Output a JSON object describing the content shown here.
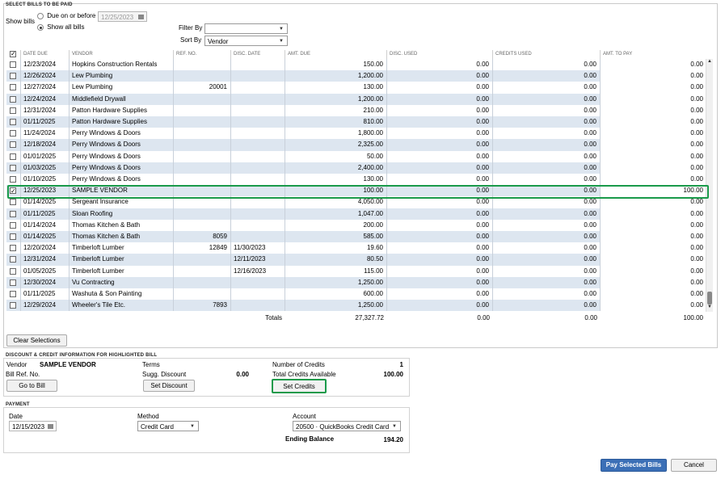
{
  "select_section": {
    "title": "SELECT BILLS TO BE PAID",
    "show_bills_label": "Show bills",
    "option_due": "Due on or before",
    "option_all": "Show all bills",
    "due_date": "12/25/2023",
    "filter_label": "Filter By",
    "filter_value": "",
    "sort_label": "Sort By",
    "sort_value": "Vendor"
  },
  "table": {
    "columns": [
      "DATE DUE",
      "VENDOR",
      "REF. NO.",
      "DISC. DATE",
      "AMT. DUE",
      "DISC. USED",
      "CREDITS USED",
      "AMT. TO PAY"
    ],
    "rows": [
      {
        "checked": false,
        "date": "12/23/2024",
        "vendor": "Hopkins Construction Rentals",
        "ref": "",
        "disc_date": "",
        "amt_due": "150.00",
        "disc_used": "0.00",
        "credits": "0.00",
        "to_pay": "0.00"
      },
      {
        "checked": false,
        "date": "12/26/2024",
        "vendor": "Lew Plumbing",
        "ref": "",
        "disc_date": "",
        "amt_due": "1,200.00",
        "disc_used": "0.00",
        "credits": "0.00",
        "to_pay": "0.00"
      },
      {
        "checked": false,
        "date": "12/27/2024",
        "vendor": "Lew Plumbing",
        "ref": "20001",
        "disc_date": "",
        "amt_due": "130.00",
        "disc_used": "0.00",
        "credits": "0.00",
        "to_pay": "0.00"
      },
      {
        "checked": false,
        "date": "12/24/2024",
        "vendor": "Middlefield Drywall",
        "ref": "",
        "disc_date": "",
        "amt_due": "1,200.00",
        "disc_used": "0.00",
        "credits": "0.00",
        "to_pay": "0.00"
      },
      {
        "checked": false,
        "date": "12/31/2024",
        "vendor": "Patton Hardware Supplies",
        "ref": "",
        "disc_date": "",
        "amt_due": "210.00",
        "disc_used": "0.00",
        "credits": "0.00",
        "to_pay": "0.00"
      },
      {
        "checked": false,
        "date": "01/11/2025",
        "vendor": "Patton Hardware Supplies",
        "ref": "",
        "disc_date": "",
        "amt_due": "810.00",
        "disc_used": "0.00",
        "credits": "0.00",
        "to_pay": "0.00"
      },
      {
        "checked": false,
        "date": "11/24/2024",
        "vendor": "Perry Windows & Doors",
        "ref": "",
        "disc_date": "",
        "amt_due": "1,800.00",
        "disc_used": "0.00",
        "credits": "0.00",
        "to_pay": "0.00"
      },
      {
        "checked": false,
        "date": "12/18/2024",
        "vendor": "Perry Windows & Doors",
        "ref": "",
        "disc_date": "",
        "amt_due": "2,325.00",
        "disc_used": "0.00",
        "credits": "0.00",
        "to_pay": "0.00"
      },
      {
        "checked": false,
        "date": "01/01/2025",
        "vendor": "Perry Windows & Doors",
        "ref": "",
        "disc_date": "",
        "amt_due": "50.00",
        "disc_used": "0.00",
        "credits": "0.00",
        "to_pay": "0.00"
      },
      {
        "checked": false,
        "date": "01/03/2025",
        "vendor": "Perry Windows & Doors",
        "ref": "",
        "disc_date": "",
        "amt_due": "2,400.00",
        "disc_used": "0.00",
        "credits": "0.00",
        "to_pay": "0.00"
      },
      {
        "checked": false,
        "date": "01/10/2025",
        "vendor": "Perry Windows & Doors",
        "ref": "",
        "disc_date": "",
        "amt_due": "130.00",
        "disc_used": "0.00",
        "credits": "0.00",
        "to_pay": "0.00"
      },
      {
        "checked": true,
        "date": "12/25/2023",
        "vendor": "SAMPLE VENDOR",
        "ref": "",
        "disc_date": "",
        "amt_due": "100.00",
        "disc_used": "0.00",
        "credits": "0.00",
        "to_pay": "100.00"
      },
      {
        "checked": false,
        "date": "01/14/2025",
        "vendor": "Sergeant Insurance",
        "ref": "",
        "disc_date": "",
        "amt_due": "4,050.00",
        "disc_used": "0.00",
        "credits": "0.00",
        "to_pay": "0.00"
      },
      {
        "checked": false,
        "date": "01/11/2025",
        "vendor": "Sloan Roofing",
        "ref": "",
        "disc_date": "",
        "amt_due": "1,047.00",
        "disc_used": "0.00",
        "credits": "0.00",
        "to_pay": "0.00"
      },
      {
        "checked": false,
        "date": "01/14/2024",
        "vendor": "Thomas Kitchen & Bath",
        "ref": "",
        "disc_date": "",
        "amt_due": "200.00",
        "disc_used": "0.00",
        "credits": "0.00",
        "to_pay": "0.00"
      },
      {
        "checked": false,
        "date": "01/14/2025",
        "vendor": "Thomas Kitchen & Bath",
        "ref": "8059",
        "disc_date": "",
        "amt_due": "585.00",
        "disc_used": "0.00",
        "credits": "0.00",
        "to_pay": "0.00"
      },
      {
        "checked": false,
        "date": "12/20/2024",
        "vendor": "Timberloft Lumber",
        "ref": "12849",
        "disc_date": "11/30/2023",
        "amt_due": "19.60",
        "disc_used": "0.00",
        "credits": "0.00",
        "to_pay": "0.00"
      },
      {
        "checked": false,
        "date": "12/31/2024",
        "vendor": "Timberloft Lumber",
        "ref": "",
        "disc_date": "12/11/2023",
        "amt_due": "80.50",
        "disc_used": "0.00",
        "credits": "0.00",
        "to_pay": "0.00"
      },
      {
        "checked": false,
        "date": "01/05/2025",
        "vendor": "Timberloft Lumber",
        "ref": "",
        "disc_date": "12/16/2023",
        "amt_due": "115.00",
        "disc_used": "0.00",
        "credits": "0.00",
        "to_pay": "0.00"
      },
      {
        "checked": false,
        "date": "12/30/2024",
        "vendor": "Vu Contracting",
        "ref": "",
        "disc_date": "",
        "amt_due": "1,250.00",
        "disc_used": "0.00",
        "credits": "0.00",
        "to_pay": "0.00"
      },
      {
        "checked": false,
        "date": "01/11/2025",
        "vendor": "Washuta & Son Painting",
        "ref": "",
        "disc_date": "",
        "amt_due": "600.00",
        "disc_used": "0.00",
        "credits": "0.00",
        "to_pay": "0.00"
      },
      {
        "checked": false,
        "date": "12/29/2024",
        "vendor": "Wheeler's Tile Etc.",
        "ref": "7893",
        "disc_date": "",
        "amt_due": "1,250.00",
        "disc_used": "0.00",
        "credits": "0.00",
        "to_pay": "0.00"
      }
    ],
    "totals_label": "Totals",
    "totals": {
      "amt_due": "27,327.72",
      "disc_used": "0.00",
      "credits": "0.00",
      "to_pay": "100.00"
    }
  },
  "clear_button": "Clear Selections",
  "discount_section": {
    "title": "DISCOUNT & CREDIT INFORMATION FOR HIGHLIGHTED BILL",
    "vendor_label": "Vendor",
    "vendor_value": "SAMPLE VENDOR",
    "bill_ref_label": "Bill Ref. No.",
    "terms_label": "Terms",
    "sugg_discount_label": "Sugg. Discount",
    "sugg_discount_value": "0.00",
    "num_credits_label": "Number of Credits",
    "num_credits_value": "1",
    "total_credits_label": "Total Credits Available",
    "total_credits_value": "100.00",
    "go_to_bill": "Go to Bill",
    "set_discount": "Set Discount",
    "set_credits": "Set Credits"
  },
  "payment_section": {
    "title": "PAYMENT",
    "date_label": "Date",
    "date_value": "12/15/2023",
    "method_label": "Method",
    "method_value": "Credit Card",
    "account_label": "Account",
    "account_value": "20500 · QuickBooks Credit Card",
    "ending_balance_label": "Ending Balance",
    "ending_balance_value": "194.20"
  },
  "footer": {
    "pay_button": "Pay Selected Bills",
    "cancel_button": "Cancel"
  },
  "colors": {
    "row_alt": "#dde6f0",
    "highlight": "#1a9a4a",
    "primary": "#3b6fb6"
  }
}
